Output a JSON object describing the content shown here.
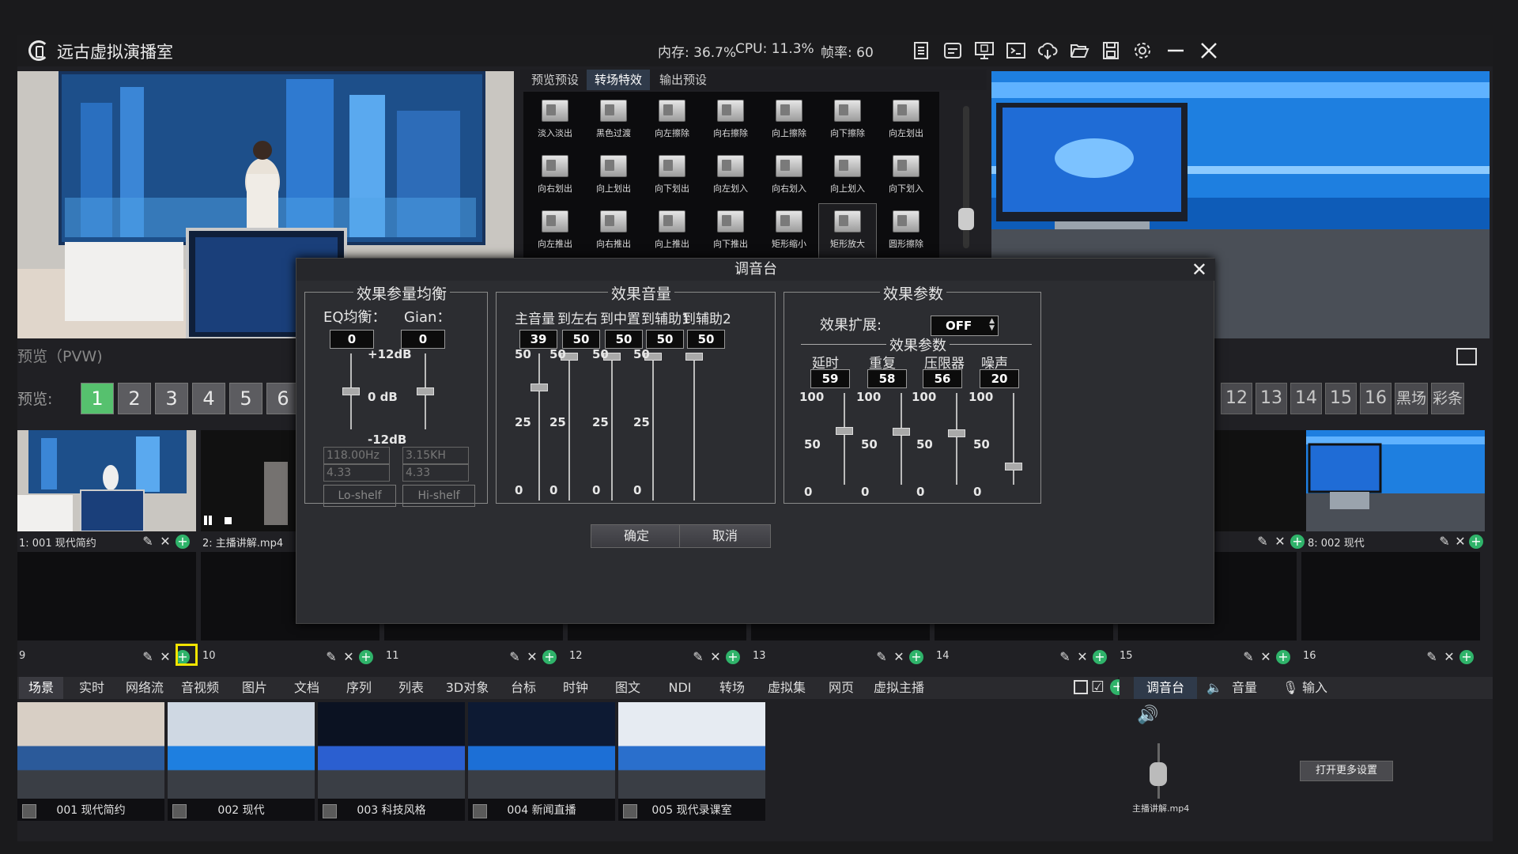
{
  "app": {
    "title": "远古虚拟演播室"
  },
  "stats": {
    "memory": "内存: 36.7%",
    "cpu": "CPU: 11.3%",
    "fps": "帧率: 60"
  },
  "transitions": {
    "tabs": [
      "预览预设",
      "转场特效",
      "输出预设"
    ],
    "active_tab": 1,
    "items": [
      "淡入淡出",
      "黑色过渡",
      "向左擦除",
      "向右擦除",
      "向上擦除",
      "向下擦除",
      "向左划出",
      "向右划出",
      "向上划出",
      "向下划出",
      "向左划入",
      "向右划入",
      "向上划入",
      "向下划入",
      "向左推出",
      "向右推出",
      "向上推出",
      "向下推出",
      "矩形缩小",
      "矩形放大",
      "圆形擦除"
    ],
    "selected": 19
  },
  "preview": {
    "label": "预览（PVW)",
    "row_label": "预览:",
    "buttons": [
      "1",
      "2",
      "3",
      "4",
      "5",
      "6"
    ],
    "active": 0,
    "right_buttons": [
      "12",
      "13",
      "14",
      "15",
      "16",
      "黑场",
      "彩条"
    ],
    "mini_buttons": [
      "3",
      "4"
    ]
  },
  "cells": [
    {
      "label": "1:  001 现代简约"
    },
    {
      "label": "2:  主播讲解.mp4"
    },
    {
      "label": "8:  002 现代"
    },
    {
      "label": "9"
    },
    {
      "label": "10"
    },
    {
      "label": "11"
    },
    {
      "label": "12"
    },
    {
      "label": "13"
    },
    {
      "label": "14"
    },
    {
      "label": "15"
    },
    {
      "label": "16"
    }
  ],
  "categories": [
    "场景",
    "实时",
    "网络流",
    "音视频",
    "图片",
    "文档",
    "序列",
    "列表",
    "3D对象",
    "台标",
    "时钟",
    "图文",
    "NDI",
    "转场",
    "虚拟集",
    "网页",
    "虚拟主播"
  ],
  "active_category": 0,
  "mixer_tabs": [
    "调音台",
    "音量",
    "输入"
  ],
  "scenes": [
    "001 现代简约",
    "002 现代",
    "003 科技风格",
    "004 新闻直播",
    "005 现代录课室"
  ],
  "audio": {
    "file": "主播讲解.mp4",
    "more_settings": "打开更多设置"
  },
  "dialog": {
    "title": "调音台",
    "eq": {
      "group_title": "效果参量均衡",
      "eq_label": "EQ均衡：",
      "gain_label": "Gian：",
      "eq_value": "0",
      "gain_value": "0",
      "scale_top": "+12dB",
      "scale_mid": "0  dB",
      "scale_bot": "-12dB",
      "lo_freq": "118.00Hz",
      "lo_q": "4.33",
      "hi_freq": "3.15KH",
      "hi_q": "4.33",
      "lo_btn": "Lo-shelf",
      "hi_btn": "Hi-shelf",
      "eq_level": 0.5,
      "gain_level": 0.5
    },
    "volume": {
      "group_title": "效果音量",
      "channels": [
        {
          "label": "主音量",
          "value": "39"
        },
        {
          "label": "到左右",
          "value": "50"
        },
        {
          "label": "到中置",
          "value": "50"
        },
        {
          "label": "到辅助1",
          "value": "50"
        },
        {
          "label": "到辅助2",
          "value": "50"
        }
      ],
      "scale": [
        "50",
        "25",
        "0"
      ]
    },
    "effects": {
      "group_title": "效果参数",
      "expand_label": "效果扩展:",
      "expand_value": "OFF",
      "sub_title": "效果参数",
      "channels": [
        {
          "label": "延时",
          "value": "59"
        },
        {
          "label": "重复",
          "value": "58"
        },
        {
          "label": "压限器",
          "value": "56"
        },
        {
          "label": "噪声",
          "value": "20"
        }
      ],
      "scale": [
        "100",
        "50",
        "0"
      ]
    },
    "ok": "确定",
    "cancel": "取消"
  },
  "colors": {
    "accent_green": "#56c16e",
    "highlight": "#f3e400",
    "tab_active": "#2f3a4a"
  }
}
